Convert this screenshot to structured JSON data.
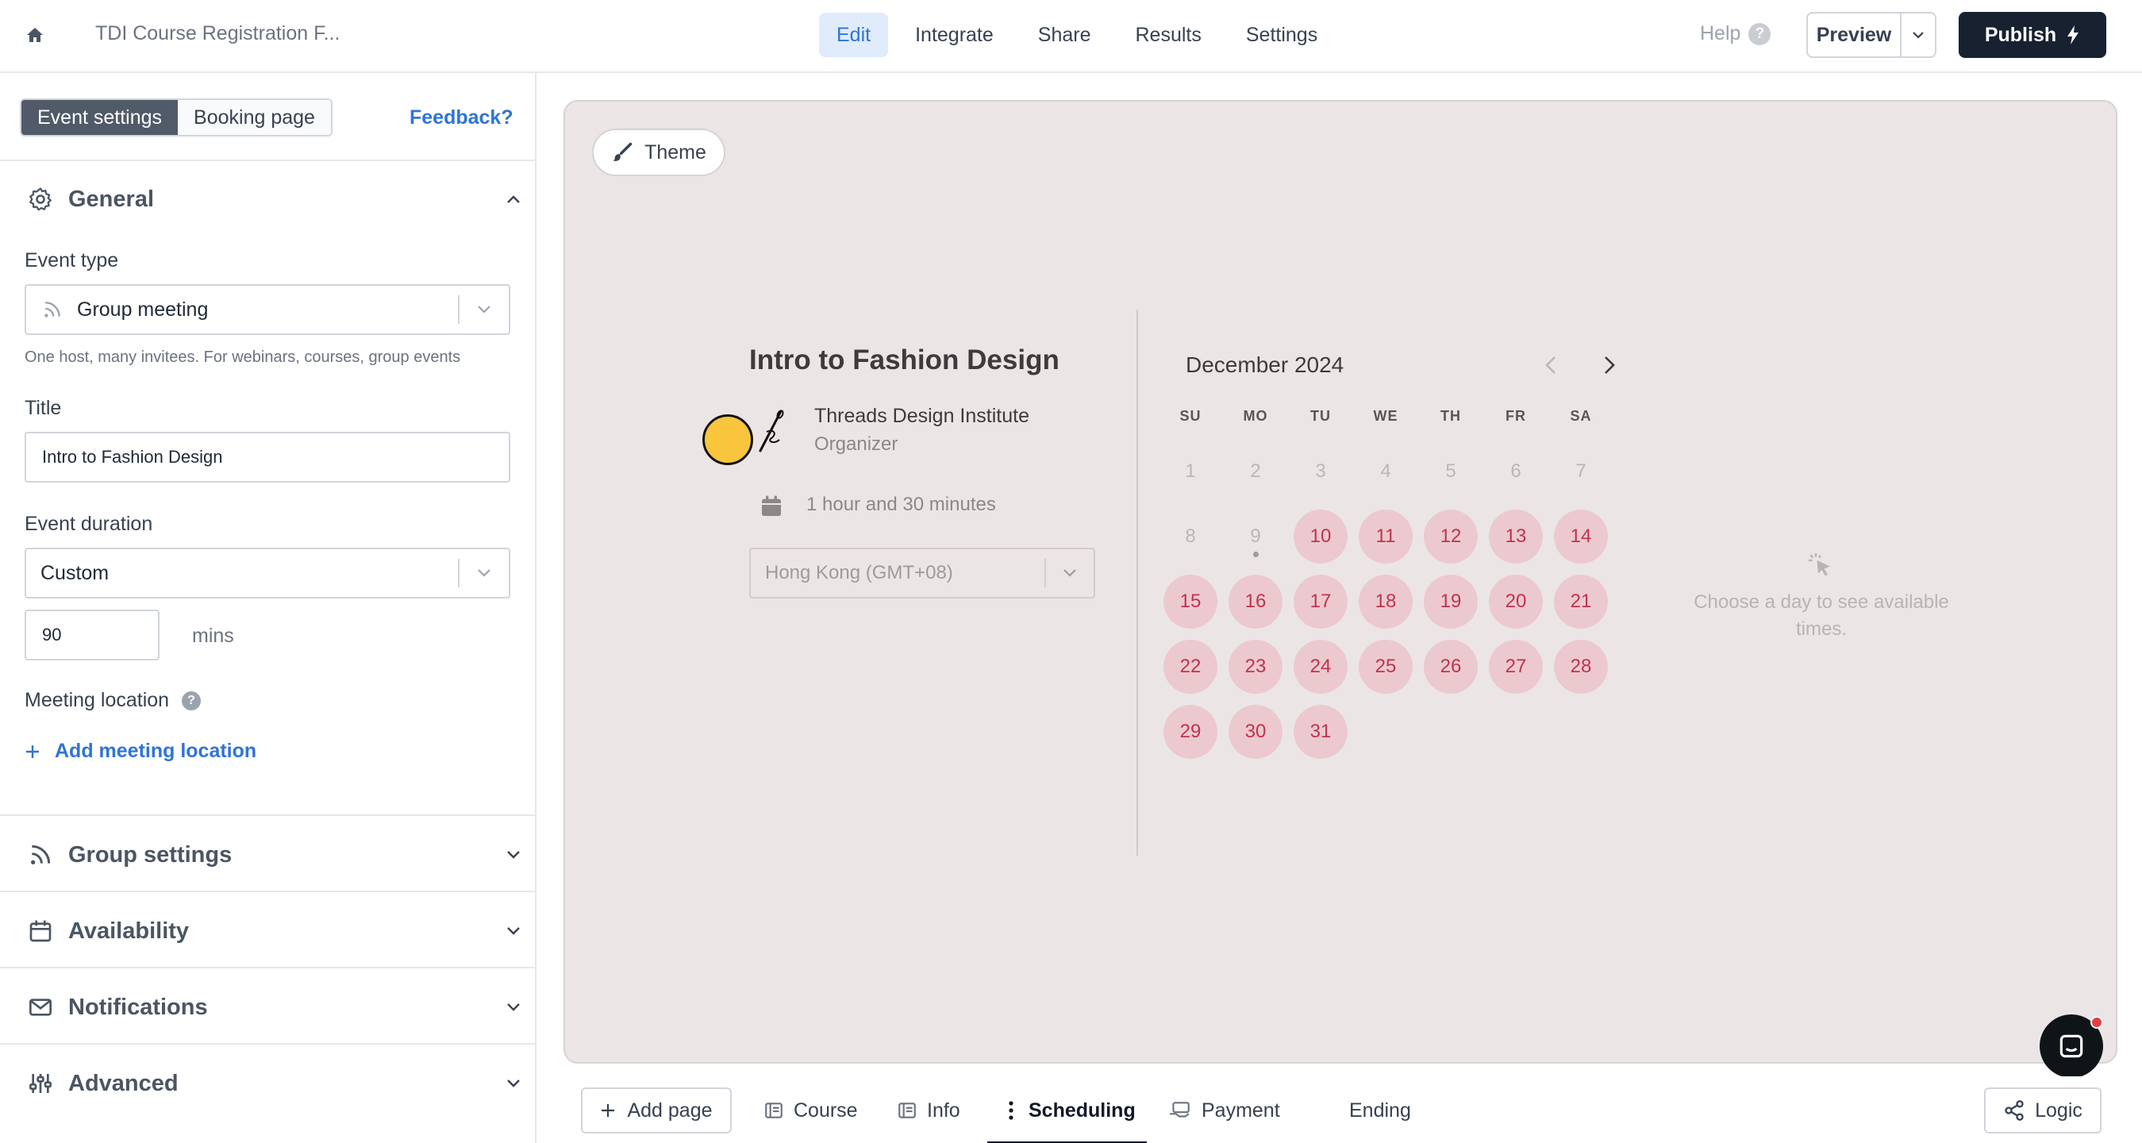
{
  "topbar": {
    "form_title": "TDI Course Registration F...",
    "nav": [
      {
        "label": "Edit",
        "active": true
      },
      {
        "label": "Integrate",
        "active": false
      },
      {
        "label": "Share",
        "active": false
      },
      {
        "label": "Results",
        "active": false
      },
      {
        "label": "Settings",
        "active": false
      }
    ],
    "help_label": "Help",
    "help_mark": "?",
    "preview_label": "Preview",
    "publish_label": "Publish"
  },
  "sidebar": {
    "tabs": {
      "event_settings": "Event settings",
      "booking_page": "Booking page"
    },
    "feedback_label": "Feedback?",
    "sections": {
      "general": "General",
      "group_settings": "Group settings",
      "availability": "Availability",
      "notifications": "Notifications",
      "advanced": "Advanced"
    },
    "event_type": {
      "label": "Event type",
      "value": "Group meeting",
      "hint": "One host, many invitees. For webinars, courses, group events"
    },
    "title": {
      "label": "Title",
      "value": "Intro to Fashion Design"
    },
    "duration": {
      "label": "Event duration",
      "value": "Custom",
      "minutes": "90",
      "unit": "mins"
    },
    "location": {
      "label": "Meeting location",
      "help_mark": "?",
      "add_label": "Add meeting location"
    }
  },
  "canvas": {
    "theme_label": "Theme",
    "event_title": "Intro to Fashion Design",
    "organizer_name": "Threads Design Institute",
    "organizer_role": "Organizer",
    "duration_text": "1 hour and 30 minutes",
    "timezone": "Hong Kong (GMT+08)",
    "calendar": {
      "month": "December 2024",
      "weekdays": [
        "SU",
        "MO",
        "TU",
        "WE",
        "TH",
        "FR",
        "SA"
      ],
      "days": [
        "1",
        "2",
        "3",
        "4",
        "5",
        "6",
        "7",
        "8",
        "9",
        "10",
        "11",
        "12",
        "13",
        "14",
        "15",
        "16",
        "17",
        "18",
        "19",
        "20",
        "21",
        "22",
        "23",
        "24",
        "25",
        "26",
        "27",
        "28",
        "29",
        "30",
        "31"
      ],
      "first_available_day": 10
    },
    "empty_state": "Choose a day to see available times."
  },
  "bottombar": {
    "add_page_label": "Add page",
    "pages": [
      {
        "label": "Course",
        "icon": "form-page-icon",
        "active": false
      },
      {
        "label": "Info",
        "icon": "form-page-icon",
        "active": false
      },
      {
        "label": "Scheduling",
        "icon": "drag-handle-icon",
        "active": true
      },
      {
        "label": "Payment",
        "icon": "payment-icon",
        "active": false
      },
      {
        "label": "Ending",
        "icon": "",
        "active": false
      }
    ],
    "logic_label": "Logic"
  },
  "colors": {
    "accent": "#2f74d6",
    "publish_bg": "#18212f",
    "canvas_bg": "#ebe6e5",
    "day_available_bg": "#ecc9cf",
    "day_available_text": "#c0334e",
    "organizer_avatar": "#f9c53d"
  }
}
